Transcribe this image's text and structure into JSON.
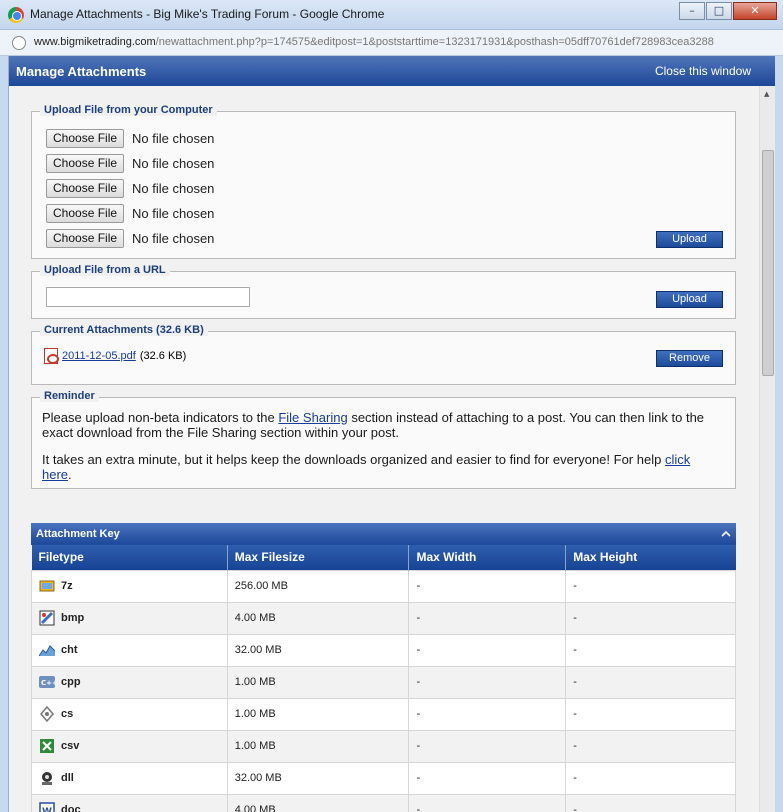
{
  "window": {
    "title": "Manage Attachments - Big Mike's Trading Forum - Google Chrome",
    "url_domain": "www.bigmiketrading.com",
    "url_path": "/newattachment.php?p=174575&editpost=1&poststarttime=1323171931&posthash=05dff70761def728983cea3288"
  },
  "header": {
    "title": "Manage Attachments",
    "close_label": "Close this window"
  },
  "upload_computer": {
    "legend": "Upload File from your Computer",
    "choose_label": "Choose File",
    "no_file_text": "No file chosen",
    "rows": [
      1,
      2,
      3,
      4,
      5
    ],
    "upload_label": "Upload"
  },
  "upload_url": {
    "legend": "Upload File from a URL",
    "input_value": "",
    "upload_label": "Upload"
  },
  "current": {
    "legend": "Current Attachments (32.6 KB)",
    "file_name": "2011-12-05.pdf",
    "file_size": "(32.6 KB)",
    "remove_label": "Remove"
  },
  "reminder": {
    "legend": "Reminder",
    "p1_a": "Please upload non-beta indicators to the ",
    "p1_link": "File Sharing",
    "p1_b": " section instead of attaching to a post. You can then link to the exact download from the File Sharing section within your post.",
    "p2_a": "It takes an extra minute, but it helps keep the downloads organized and easier to find for everyone! For help ",
    "p2_link": "click here",
    "p2_b": "."
  },
  "attachment_key": {
    "title": "Attachment Key",
    "columns": [
      "Filetype",
      "Max Filesize",
      "Max Width",
      "Max Height"
    ],
    "rows": [
      {
        "type": "7z",
        "size": "256.00 MB",
        "width": "-",
        "height": "-",
        "icon": "archive-icon",
        "color": "#e8b62b"
      },
      {
        "type": "bmp",
        "size": "4.00 MB",
        "width": "-",
        "height": "-",
        "icon": "paint-icon",
        "color": "#3b6fc4"
      },
      {
        "type": "cht",
        "size": "32.00 MB",
        "width": "-",
        "height": "-",
        "icon": "chart-icon",
        "color": "#6aa0d8"
      },
      {
        "type": "cpp",
        "size": "1.00 MB",
        "width": "-",
        "height": "-",
        "icon": "cpp-icon",
        "color": "#6f8fbf"
      },
      {
        "type": "cs",
        "size": "1.00 MB",
        "width": "-",
        "height": "-",
        "icon": "cs-icon",
        "color": "#777777"
      },
      {
        "type": "csv",
        "size": "1.00 MB",
        "width": "-",
        "height": "-",
        "icon": "excel-icon",
        "color": "#2f8a3a"
      },
      {
        "type": "dll",
        "size": "32.00 MB",
        "width": "-",
        "height": "-",
        "icon": "dll-icon",
        "color": "#333333"
      },
      {
        "type": "doc",
        "size": "4.00 MB",
        "width": "-",
        "height": "-",
        "icon": "word-icon",
        "color": "#2b4fa0"
      }
    ]
  }
}
